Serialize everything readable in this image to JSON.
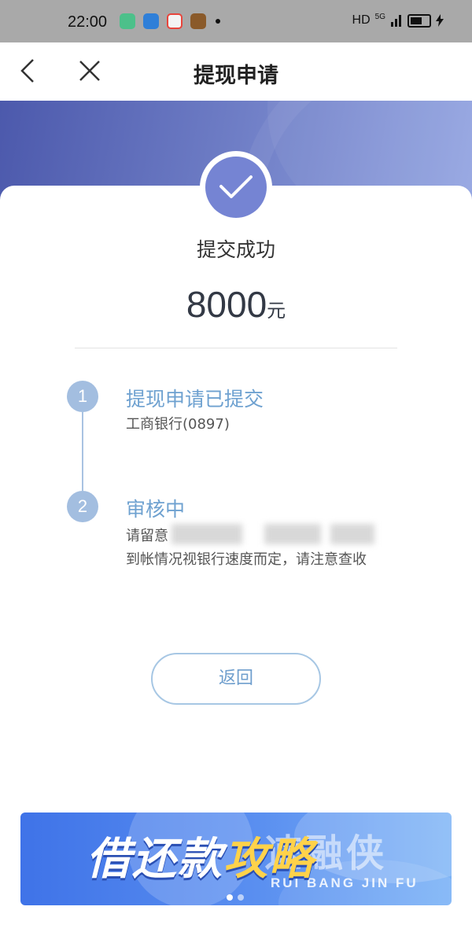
{
  "status_bar": {
    "time": "22:00",
    "network": "HD",
    "signal_label": "5G",
    "apps": [
      {
        "icon": "green-app-icon",
        "color": "#4cc08a"
      },
      {
        "icon": "blue-app-icon",
        "color": "#2f7fd8"
      },
      {
        "icon": "map-app-icon",
        "color": "#e8453c"
      },
      {
        "icon": "game-app-icon",
        "color": "#8a5a2a"
      }
    ]
  },
  "nav": {
    "title": "提现申请",
    "back_icon": "chevron-left-icon",
    "close_icon": "close-icon"
  },
  "result": {
    "status": "提交成功",
    "amount": "8000",
    "unit": "元"
  },
  "steps": [
    {
      "number": "1",
      "title": "提现申请已提交",
      "desc": "工商银行(0897)"
    },
    {
      "number": "2",
      "title": "审核中",
      "desc_line1": "请留意",
      "desc_line2": "到帐情况视银行速度而定，请注意查收"
    }
  ],
  "actions": {
    "return_label": "返回"
  },
  "banner": {
    "title_white": "借还款",
    "title_yellow": "攻略",
    "watermark": "速融侠",
    "watermark_sub": "RUI BANG JIN FU"
  },
  "colors": {
    "accent": "#7584d3",
    "step_blue": "#6ea1d0",
    "banner_blue": "#3f73e8"
  }
}
